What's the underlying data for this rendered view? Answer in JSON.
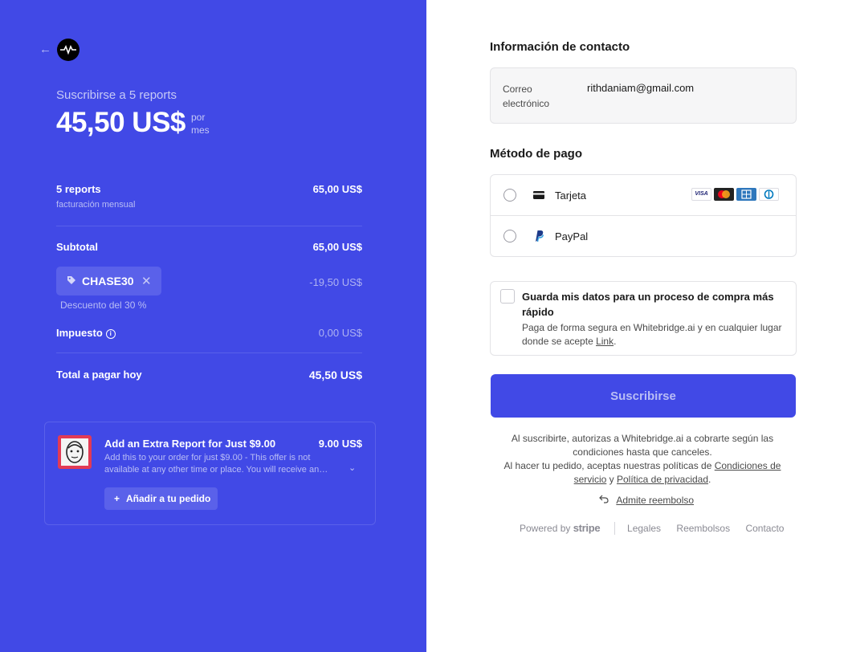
{
  "summary": {
    "subscribe_title": "Suscribirse a 5 reports",
    "price": "45,50 US$",
    "period": "por mes",
    "item": {
      "name": "5 reports",
      "billing": "facturación mensual",
      "amount": "65,00 US$"
    },
    "subtotal_label": "Subtotal",
    "subtotal_value": "65,00 US$",
    "coupon": {
      "code": "CHASE30",
      "discount_note": "Descuento del 30 %",
      "discount_value": "-19,50 US$"
    },
    "tax_label": "Impuesto",
    "tax_value": "0,00 US$",
    "total_label": "Total a pagar hoy",
    "total_value": "45,50 US$"
  },
  "upsell": {
    "title": "Add an Extra Report for Just $9.00",
    "price": "9.00 US$",
    "description": "Add this to your order for just $9.00 - This offer is not available at any other time or place. You will receive an…",
    "add_label": "Añadir a tu pedido"
  },
  "contact": {
    "section_title": "Información de contacto",
    "email_label": "Correo electrónico",
    "email_value": "rithdaniam@gmail.com"
  },
  "payment": {
    "section_title": "Método de pago",
    "card_label": "Tarjeta",
    "paypal_label": "PayPal",
    "brands": [
      "VISA",
      "Mastercard",
      "American Express",
      "Diners"
    ]
  },
  "save": {
    "title": "Guarda mis datos para un proceso de compra más rápido",
    "desc_before": "Paga de forma segura en Whitebridge.ai y en cualquier lugar donde se acepte ",
    "link": "Link",
    "desc_after": "."
  },
  "submit_label": "Suscribirse",
  "terms": {
    "line1": "Al suscribirte, autorizas a Whitebridge.ai a cobrarte según las condiciones hasta que canceles.",
    "line2_before": "Al hacer tu pedido, aceptas nuestras políticas de ",
    "conditions": "Condiciones de servicio",
    "and": " y ",
    "privacy": "Política de privacidad",
    "end": "."
  },
  "refund_label": "Admite reembolso",
  "footer": {
    "powered_by": "Powered by",
    "stripe": "stripe",
    "links": [
      "Legales",
      "Reembolsos",
      "Contacto"
    ]
  },
  "colors": {
    "accent": "#4149e6",
    "accent_light": "#5a61ea",
    "upsell_thumb": "#e23a55"
  }
}
